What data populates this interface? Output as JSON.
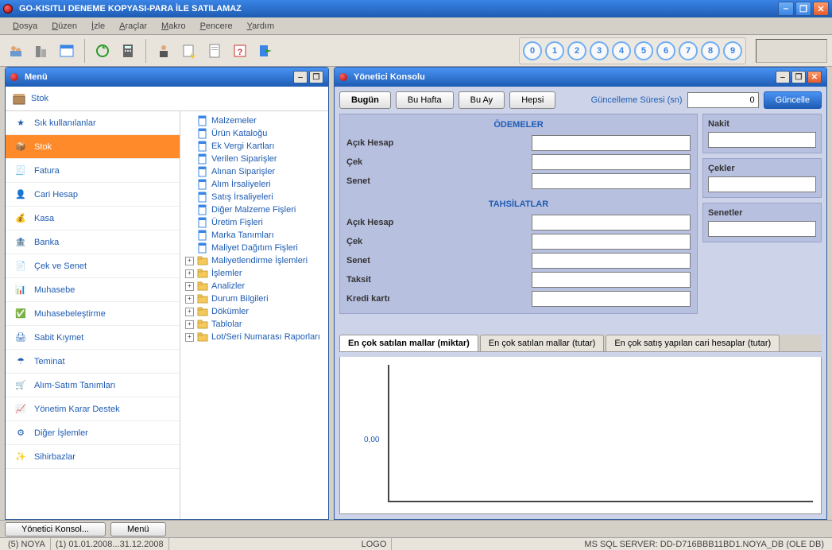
{
  "window": {
    "title": "GO-KISITLI DENEME KOPYASI-PARA İLE SATILAMAZ"
  },
  "menubar": [
    "Dosya",
    "Düzen",
    "İzle",
    "Araçlar",
    "Makro",
    "Pencere",
    "Yardım"
  ],
  "numbers": [
    "0",
    "1",
    "2",
    "3",
    "4",
    "5",
    "6",
    "7",
    "8",
    "9"
  ],
  "menuPanel": {
    "title": "Menü",
    "topLabel": "Stok",
    "nav": [
      {
        "label": "Sık kullanılanlar"
      },
      {
        "label": "Stok"
      },
      {
        "label": "Fatura"
      },
      {
        "label": "Cari Hesap"
      },
      {
        "label": "Kasa"
      },
      {
        "label": "Banka"
      },
      {
        "label": "Çek ve Senet"
      },
      {
        "label": "Muhasebe"
      },
      {
        "label": "Muhasebeleştirme"
      },
      {
        "label": "Sabit Kıymet"
      },
      {
        "label": "Teminat"
      },
      {
        "label": "Alım-Satım Tanımları"
      },
      {
        "label": "Yönetim Karar Destek"
      },
      {
        "label": "Diğer İşlemler"
      },
      {
        "label": "Sihirbazlar"
      }
    ],
    "tree": [
      {
        "label": "Malzemeler",
        "type": "doc"
      },
      {
        "label": "Ürün Kataloğu",
        "type": "doc"
      },
      {
        "label": "Ek Vergi Kartları",
        "type": "doc"
      },
      {
        "label": "Verilen Siparişler",
        "type": "doc"
      },
      {
        "label": "Alınan Siparişler",
        "type": "doc"
      },
      {
        "label": "Alım İrsaliyeleri",
        "type": "doc"
      },
      {
        "label": "Satış İrsaliyeleri",
        "type": "doc"
      },
      {
        "label": "Diğer Malzeme Fişleri",
        "type": "doc"
      },
      {
        "label": "Üretim Fişleri",
        "type": "doc"
      },
      {
        "label": "Marka Tanımları",
        "type": "doc"
      },
      {
        "label": "Maliyet Dağıtım Fişleri",
        "type": "doc"
      },
      {
        "label": "Maliyetlendirme İşlemleri",
        "type": "folder",
        "exp": true
      },
      {
        "label": "İşlemler",
        "type": "folder",
        "exp": true
      },
      {
        "label": "Analizler",
        "type": "folder",
        "exp": true
      },
      {
        "label": "Durum Bilgileri",
        "type": "folder",
        "exp": true
      },
      {
        "label": "Dökümler",
        "type": "folder",
        "exp": true
      },
      {
        "label": "Tablolar",
        "type": "folder",
        "exp": true
      },
      {
        "label": "Lot/Seri Numarası Raporları",
        "type": "folder",
        "exp": true
      }
    ]
  },
  "console": {
    "title": "Yönetici Konsolu",
    "buttons": {
      "today": "Bugün",
      "week": "Bu Hafta",
      "month": "Bu Ay",
      "all": "Hepsi",
      "update": "Güncelle"
    },
    "updateLabel": "Güncelleme Süresi (sn)",
    "updateValue": "0",
    "sections": {
      "odemeler": {
        "title": "ÖDEMELER",
        "rows": [
          "Açık Hesap",
          "Çek",
          "Senet"
        ]
      },
      "tahsilatlar": {
        "title": "TAHSİLATLAR",
        "rows": [
          "Açık Hesap",
          "Çek",
          "Senet",
          "Taksit",
          "Kredi kartı"
        ]
      }
    },
    "sideBoxes": [
      {
        "title": "Nakit"
      },
      {
        "title": "Çekler"
      },
      {
        "title": "Senetler"
      }
    ],
    "tabs": [
      "En çok satılan mallar (miktar)",
      "En çok satılan mallar (tutar)",
      "En çok satış yapılan cari hesaplar (tutar)"
    ]
  },
  "chart_data": {
    "type": "bar",
    "categories": [],
    "values": [],
    "title": "",
    "xlabel": "",
    "ylabel": "",
    "ylim": [
      0,
      0
    ],
    "yticks": [
      "0,00"
    ]
  },
  "bottomBar": {
    "console": "Yönetici Konsol...",
    "menu": "Menü"
  },
  "statusBar": {
    "left1": "(5) NOYA",
    "left2": "(1) 01.01.2008...31.12.2008",
    "center": "LOGO",
    "right": "MS SQL SERVER: DD-D716BBB11BD1.NOYA_DB (OLE DB)"
  }
}
